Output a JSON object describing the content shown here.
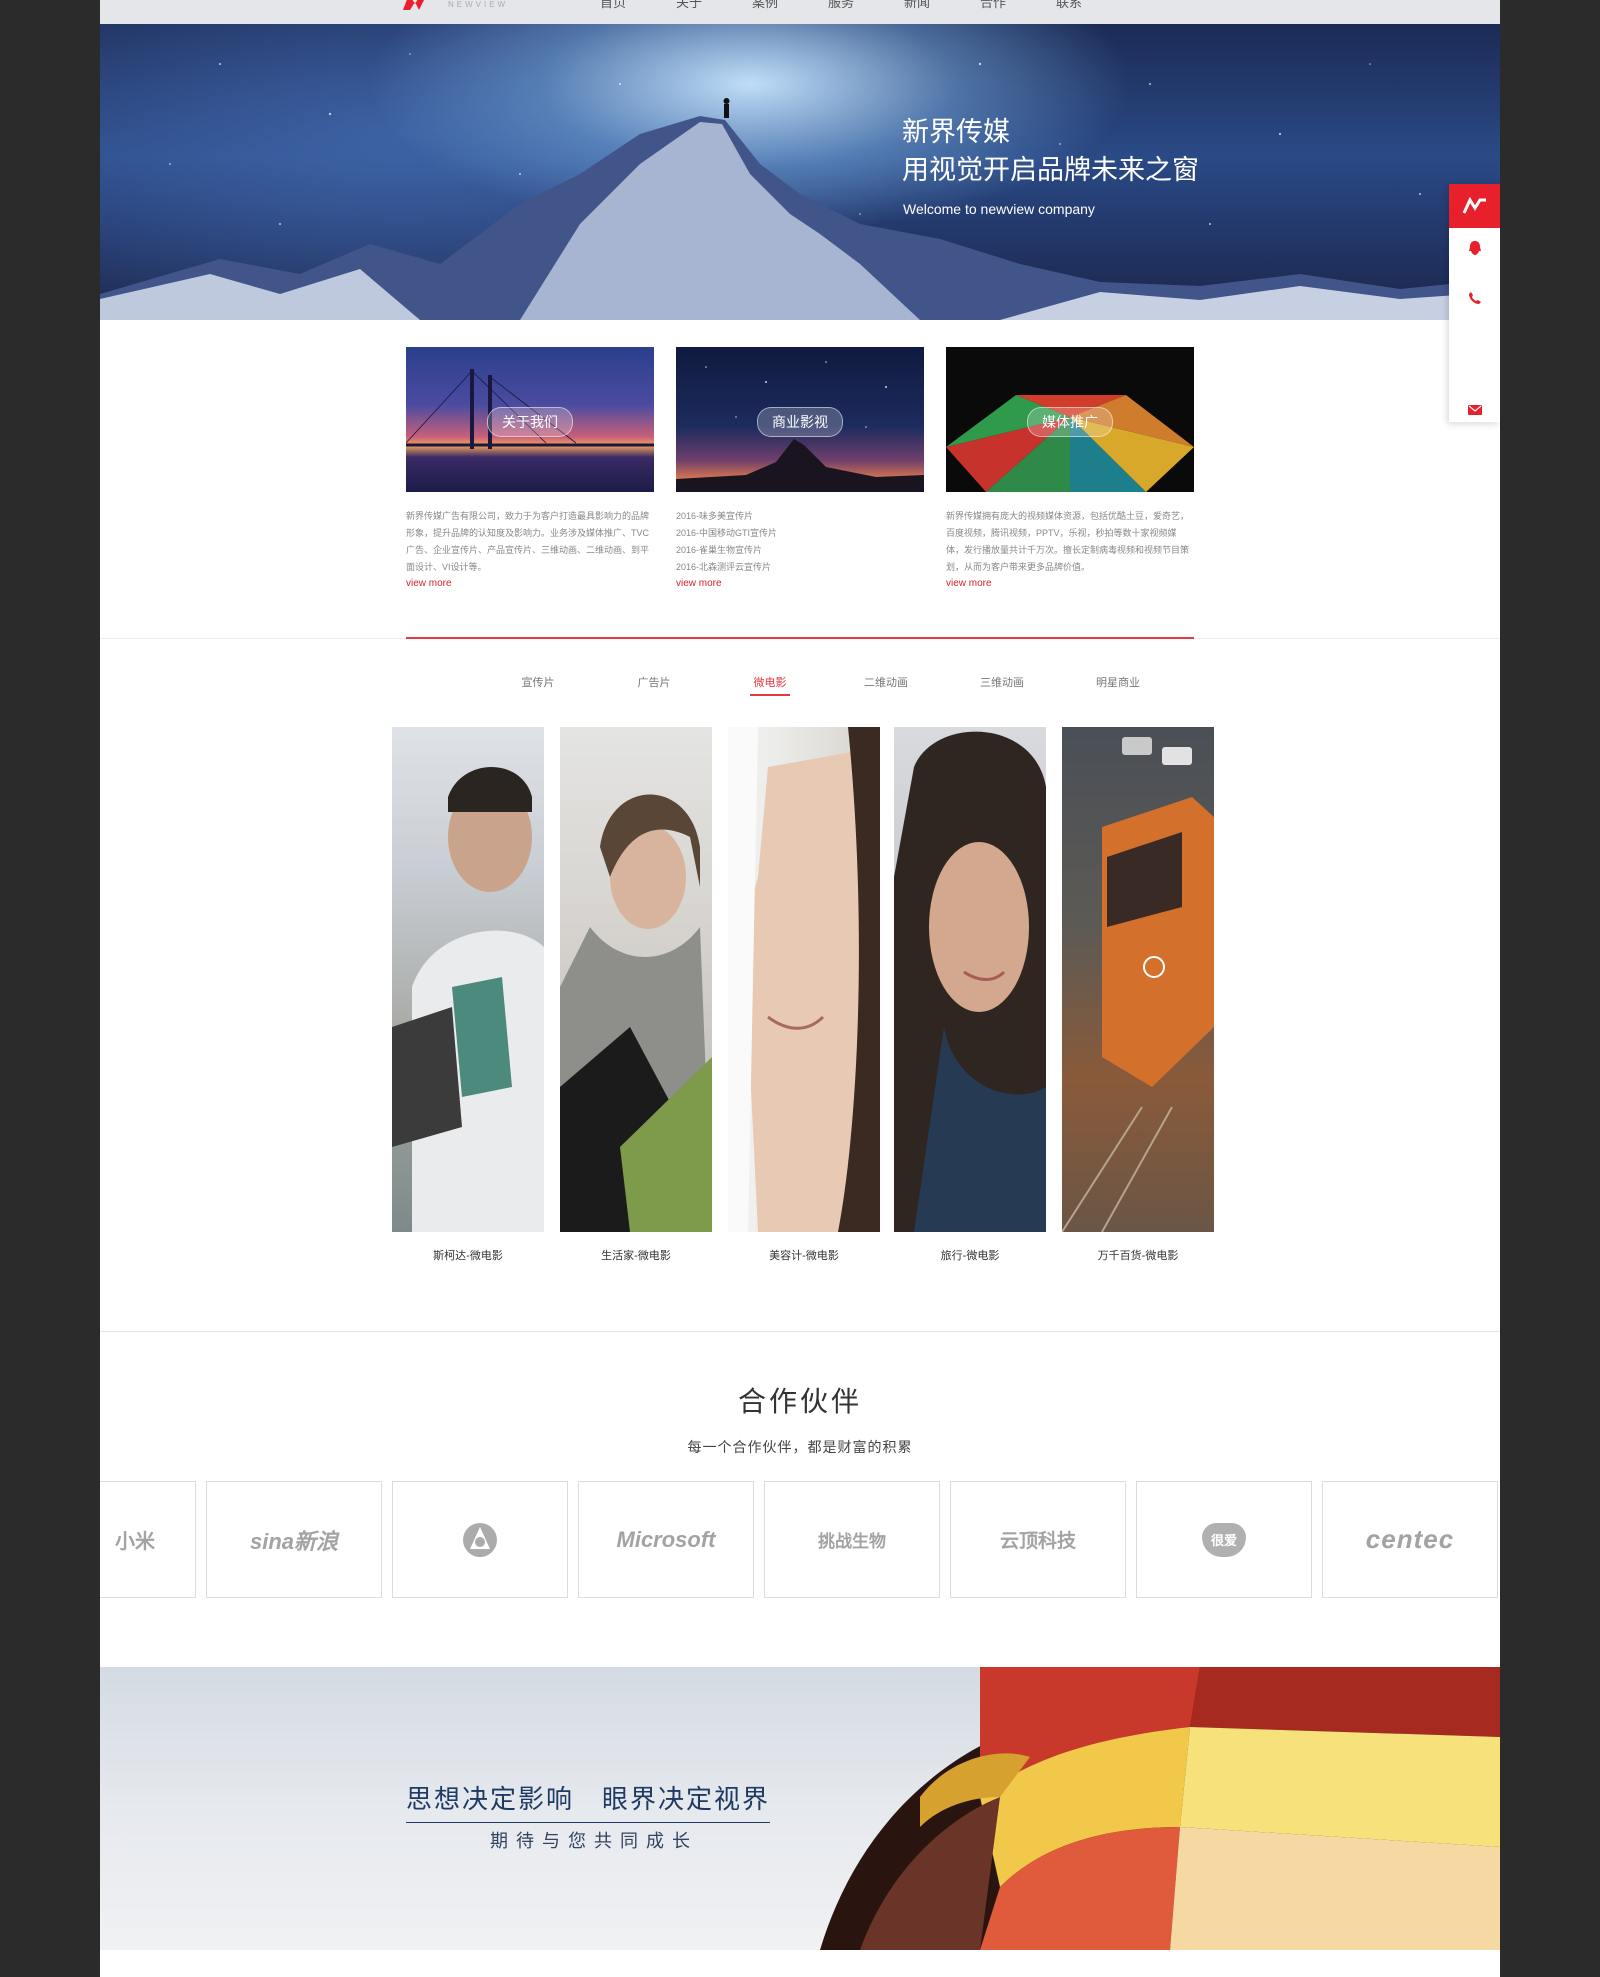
{
  "nav": {
    "logo_text": "NEWVIEW",
    "items": [
      "首页",
      "关于",
      "案例",
      "服务",
      "新闻",
      "合作",
      "联系"
    ]
  },
  "hero": {
    "title_line1": "新界传媒",
    "title_line2": "用视觉开启品牌未来之窗",
    "subtitle": "Welcome to newview company"
  },
  "side_float": {
    "icons": [
      "logo-icon",
      "qq-icon",
      "phone-icon",
      "mail-icon"
    ],
    "accent": "#e7202b"
  },
  "cards": [
    {
      "tag": "关于我们",
      "text": "新界传媒广告有限公司，致力于为客户打造最具影响力的品牌形象，提升品牌的认知度及影响力。业务涉及媒体推广、TVC广告、企业宣传片、产品宣传片、三维动画、二维动画、到平面设计、VI设计等。",
      "more": "view more"
    },
    {
      "tag": "商业影视",
      "lines": [
        "2016-味多美宣传片",
        "2016-中国移动GTI宣传片",
        "2016-雀巢生物宣传片",
        "2016-北森测评云宣传片"
      ],
      "more": "view more"
    },
    {
      "tag": "媒体推广",
      "text": "新界传媒拥有庞大的视频媒体资源，包括优酷土豆，爱奇艺，百度视频，腾讯视频，PPTV，乐视，秒拍等数十家视频媒体，发行播放量共计千万次。擅长定制病毒视频和视频节目策划，从而为客户带来更多品牌价值。",
      "more": "view more"
    }
  ],
  "tabs": {
    "items": [
      "宣传片",
      "广告片",
      "微电影",
      "二维动画",
      "三维动画",
      "明星商业"
    ],
    "active_index": 2
  },
  "films": [
    "斯柯达-微电影",
    "生活家-微电影",
    "美容计-微电影",
    "旅行-微电影",
    "万千百货-微电影"
  ],
  "partners": {
    "title": "合作伙伴",
    "subtitle": "每一个合作伙伴，都是财富的积累",
    "logos": [
      "小米",
      "sina新浪",
      "",
      "Microsoft",
      "挑战生物",
      "云顶科技",
      "很爱",
      "centec"
    ]
  },
  "banner": {
    "title": "思想决定影响　眼界决定视界",
    "subtitle": "期待与您共同成长"
  },
  "colors": {
    "accent": "#e23a40",
    "text_dark": "#333333",
    "banner_text": "#1f3a63"
  }
}
